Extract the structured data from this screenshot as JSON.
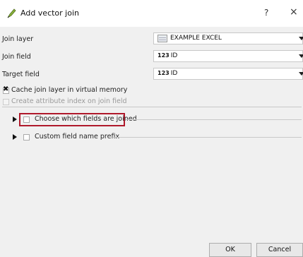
{
  "dialog": {
    "title": "Add vector join",
    "help_label": "?",
    "close_label": "×"
  },
  "fields": {
    "join_layer": {
      "label": "Join layer",
      "value": "EXAMPLE EXCEL"
    },
    "join_field": {
      "label": "Join field",
      "type_prefix": "123",
      "value": "ID"
    },
    "target_field": {
      "label": "Target field",
      "type_prefix": "123",
      "value": "ID"
    }
  },
  "options": {
    "cache": {
      "label": "Cache join layer in virtual memory",
      "checked": true
    },
    "attribute_index": {
      "label": "Create attribute index on join field",
      "checked": false,
      "enabled": false
    }
  },
  "groups": {
    "choose_fields": {
      "label": "Choose which fields are joined",
      "checked": false,
      "expanded": false
    },
    "custom_prefix": {
      "label": "Custom field name prefix",
      "checked": false,
      "expanded": false
    }
  },
  "buttons": {
    "ok": "OK",
    "cancel": "Cancel"
  },
  "colors": {
    "highlight_border": "#b0192b",
    "title_icon": "#8bb43c"
  }
}
